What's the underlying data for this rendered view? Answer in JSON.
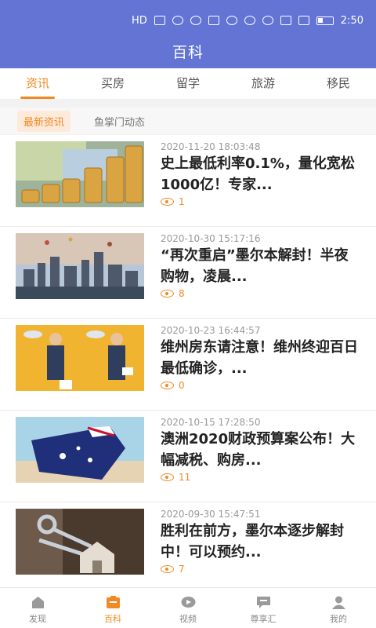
{
  "statusbar": {
    "hd": "HD",
    "time": "2:50"
  },
  "header": {
    "title": "百科"
  },
  "tabs": [
    {
      "label": "资讯",
      "active": true
    },
    {
      "label": "买房",
      "active": false
    },
    {
      "label": "留学",
      "active": false
    },
    {
      "label": "旅游",
      "active": false
    },
    {
      "label": "移民",
      "active": false
    }
  ],
  "subtabs": [
    {
      "label": "最新资讯",
      "active": true
    },
    {
      "label": "鱼掌门动态",
      "active": false
    }
  ],
  "articles": [
    {
      "time": "2020-11-20 18:03:48",
      "title": "史上最低利率0.1%，量化宽松1000亿！专家...",
      "views": "1"
    },
    {
      "time": "2020-10-30 15:17:16",
      "title": "“再次重启”墨尔本解封！半夜购物，凌晨...",
      "views": "8"
    },
    {
      "time": "2020-10-23 16:44:57",
      "title": "维州房东请注意！维州终迎百日最低确诊，...",
      "views": "0"
    },
    {
      "time": "2020-10-15 17:28:50",
      "title": "澳洲2020财政预算案公布！大幅减税、购房...",
      "views": "11"
    },
    {
      "time": "2020-09-30 15:47:51",
      "title": "胜利在前方，墨尔本逐步解封中！可以预约...",
      "views": "7"
    }
  ],
  "bottomnav": [
    {
      "label": "发现",
      "active": false
    },
    {
      "label": "百科",
      "active": true
    },
    {
      "label": "视频",
      "active": false
    },
    {
      "label": "尊享汇",
      "active": false
    },
    {
      "label": "我的",
      "active": false
    }
  ],
  "colors": {
    "header": "#6374d4",
    "accent": "#f08a24"
  }
}
